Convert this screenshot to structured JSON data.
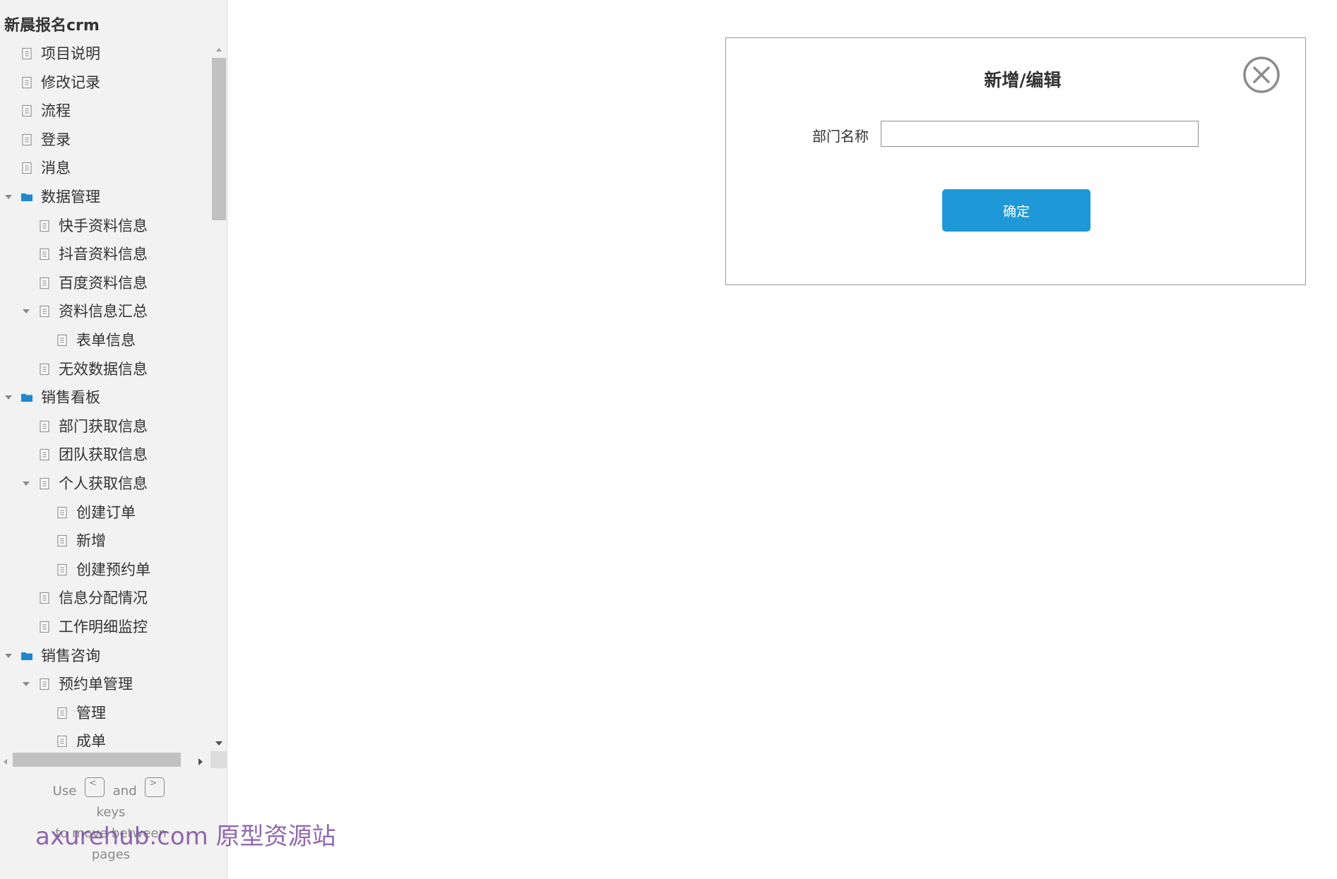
{
  "app": {
    "title": "新晨报名crm"
  },
  "sidebar": {
    "items": [
      {
        "label": "项目说明",
        "type": "page",
        "level": 0,
        "expanded": false
      },
      {
        "label": "修改记录",
        "type": "page",
        "level": 0,
        "expanded": false
      },
      {
        "label": "流程",
        "type": "page",
        "level": 0,
        "expanded": false
      },
      {
        "label": "登录",
        "type": "page",
        "level": 0,
        "expanded": false
      },
      {
        "label": "消息",
        "type": "page",
        "level": 0,
        "expanded": false
      },
      {
        "label": "数据管理",
        "type": "folder",
        "level": 0,
        "expanded": true
      },
      {
        "label": "快手资料信息",
        "type": "page",
        "level": 1,
        "expanded": false
      },
      {
        "label": "抖音资料信息",
        "type": "page",
        "level": 1,
        "expanded": false
      },
      {
        "label": "百度资料信息",
        "type": "page",
        "level": 1,
        "expanded": false
      },
      {
        "label": "资料信息汇总",
        "type": "page",
        "level": 1,
        "expanded": true
      },
      {
        "label": "表单信息",
        "type": "page",
        "level": 2,
        "expanded": false
      },
      {
        "label": "无效数据信息",
        "type": "page",
        "level": 1,
        "expanded": false
      },
      {
        "label": "销售看板",
        "type": "folder",
        "level": 0,
        "expanded": true
      },
      {
        "label": "部门获取信息",
        "type": "page",
        "level": 1,
        "expanded": false
      },
      {
        "label": "团队获取信息",
        "type": "page",
        "level": 1,
        "expanded": false
      },
      {
        "label": "个人获取信息",
        "type": "page",
        "level": 1,
        "expanded": true
      },
      {
        "label": "创建订单",
        "type": "page",
        "level": 2,
        "expanded": false
      },
      {
        "label": "新增",
        "type": "page",
        "level": 2,
        "expanded": false
      },
      {
        "label": "创建预约单",
        "type": "page",
        "level": 2,
        "expanded": false
      },
      {
        "label": "信息分配情况",
        "type": "page",
        "level": 1,
        "expanded": false
      },
      {
        "label": "工作明细监控",
        "type": "page",
        "level": 1,
        "expanded": false
      },
      {
        "label": "销售咨询",
        "type": "folder",
        "level": 0,
        "expanded": true
      },
      {
        "label": "预约单管理",
        "type": "page",
        "level": 1,
        "expanded": true
      },
      {
        "label": "管理",
        "type": "page",
        "level": 2,
        "expanded": false
      },
      {
        "label": "成单",
        "type": "page",
        "level": 2,
        "expanded": false
      }
    ],
    "expandable_labels": [
      "数据管理",
      "资料信息汇总",
      "销售看板",
      "个人获取信息",
      "销售咨询",
      "预约单管理"
    ]
  },
  "hint": {
    "use": "Use",
    "key_prev": "<",
    "and": "and",
    "key_next": ">",
    "keys": "keys",
    "move": "to move between",
    "pages": "pages"
  },
  "watermark": "axurehub.com 原型资源站",
  "dialog": {
    "title": "新增/编辑",
    "field_label": "部门名称",
    "field_value": "",
    "confirm_label": "确定"
  },
  "colors": {
    "accent": "#1e98d7",
    "folder": "#1e88d0",
    "sidebar_bg": "#f2f2f2",
    "watermark": "#7d4ea3"
  },
  "icons": {
    "page": "page-icon",
    "folder": "folder-icon",
    "expand": "triangle-down-icon",
    "close": "close-circle-icon"
  }
}
